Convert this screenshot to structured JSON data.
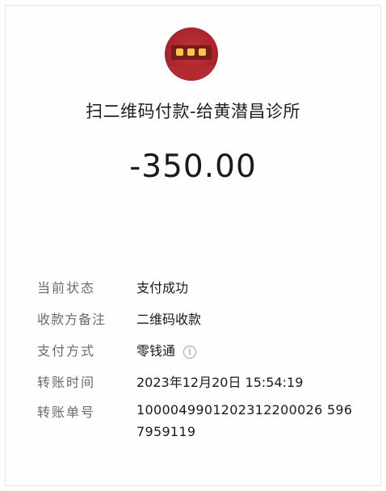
{
  "merchant": {
    "title": "扫二维码付款-给黄潜昌诊所",
    "avatar_icon": "merchant-shop-sign-avatar"
  },
  "payment": {
    "amount": "-350.00"
  },
  "details": {
    "status_label": "当前状态",
    "status_value": "支付成功",
    "payee_note_label": "收款方备注",
    "payee_note_value": "二维码收款",
    "method_label": "支付方式",
    "method_value": "零钱通",
    "method_info_icon": "info-circle-icon",
    "time_label": "转账时间",
    "time_value": "2023年12月20日 15:54:19",
    "txid_label": "转账单号",
    "txid_value": "1000049901202312200026 5967959119"
  },
  "colors": {
    "avatar_red": "#a8252b",
    "label_gray": "#6b6b6b",
    "text_dark": "#1a1a1a"
  }
}
